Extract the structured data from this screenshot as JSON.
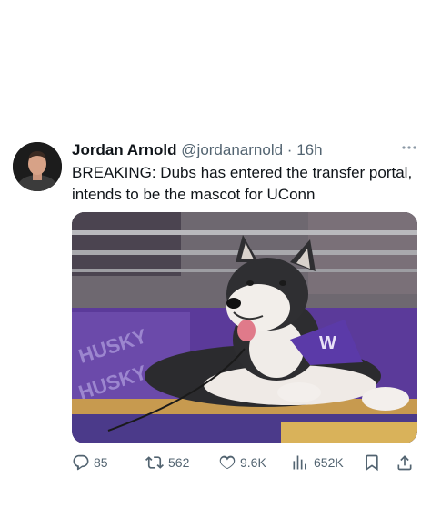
{
  "author": {
    "name": "Jordan Arnold",
    "handle": "@jordanarnold",
    "separator": "·",
    "time": "16h"
  },
  "tweet": {
    "text": "BREAKING: Dubs has entered the transfer portal, intends to be the mascot for UConn"
  },
  "media": {
    "subject": "husky-mascot-photo",
    "colors": {
      "purple": "#5b3a9a",
      "gold": "#d9b25a",
      "dark": "#3a3540"
    }
  },
  "actions": {
    "replies": "85",
    "reposts": "562",
    "likes": "9.6K",
    "views": "652K"
  },
  "icons": {
    "more": "more-icon",
    "reply": "reply-icon",
    "repost": "repost-icon",
    "like": "heart-icon",
    "views": "views-icon",
    "bookmark": "bookmark-icon",
    "share": "share-icon"
  }
}
